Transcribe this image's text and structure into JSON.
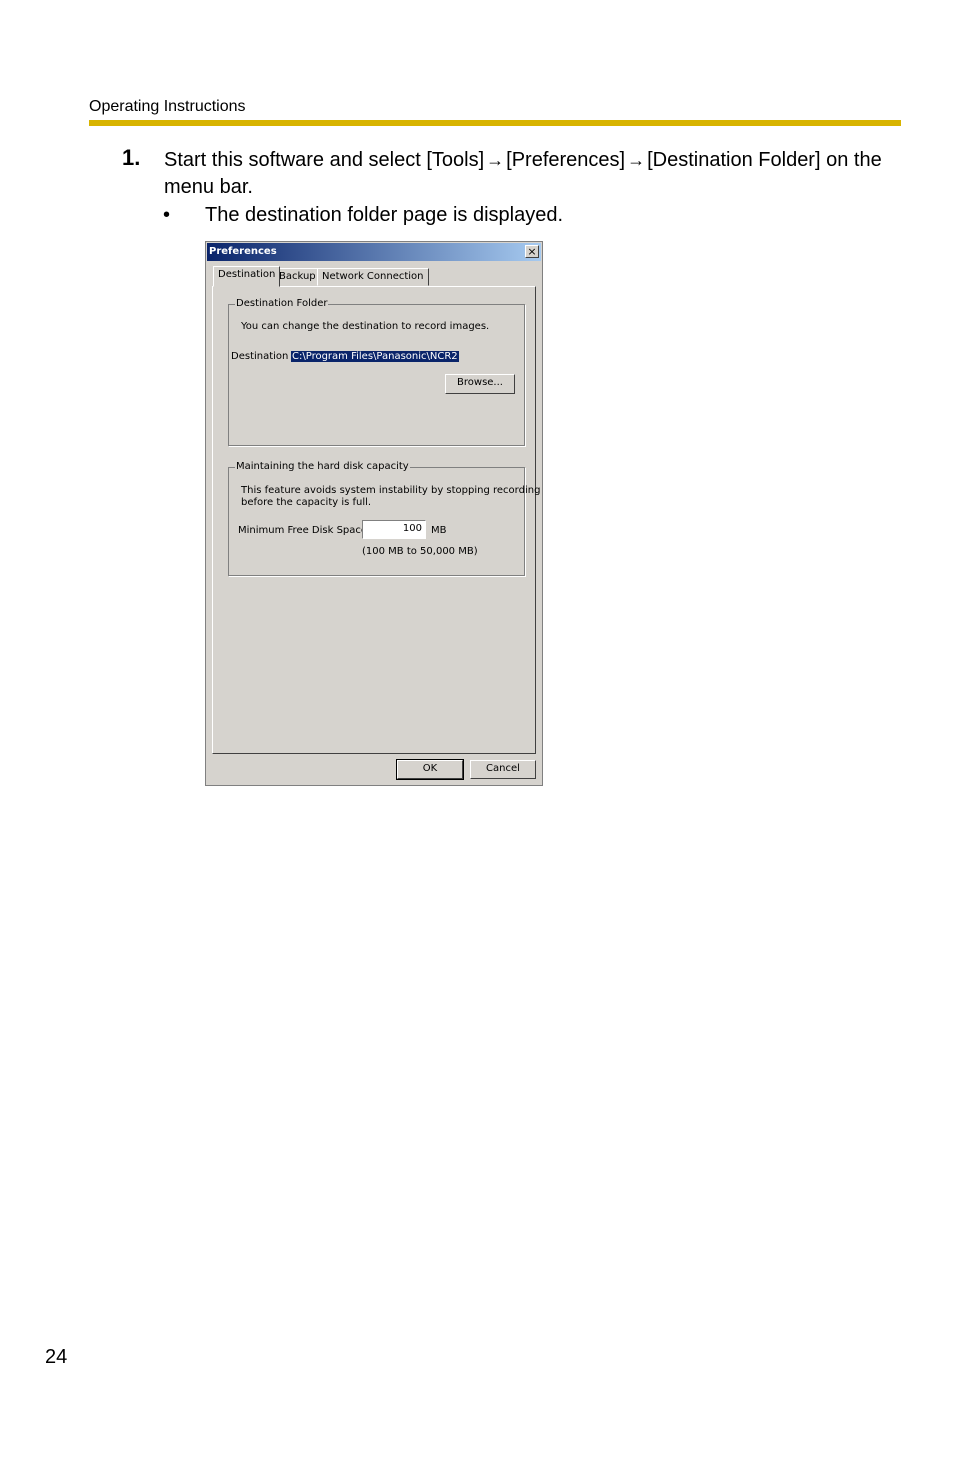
{
  "header": {
    "title": "Operating Instructions"
  },
  "step": {
    "number": "1.",
    "text_part1": "Start this software and select [Tools]",
    "arrow": "→",
    "text_part2": "[Preferences]",
    "text_part3": "[Destination Folder] on the menu bar.",
    "bullet": "•",
    "bullet_text": "The destination folder page is displayed."
  },
  "dialog": {
    "title": "Preferences",
    "close_glyph": "×",
    "tabs": [
      {
        "label": "Destination",
        "active": true
      },
      {
        "label": "Backup",
        "active": false
      },
      {
        "label": "Network Connection",
        "active": false
      }
    ],
    "destination_group": {
      "title": "Destination Folder",
      "description": "You can change the destination to record images.",
      "label": "Destination :",
      "value": "C:\\Program Files\\Panasonic\\NCR2",
      "browse_label": "Browse..."
    },
    "capacity_group": {
      "title": "Maintaining the hard disk capacity",
      "description_line1": "This feature avoids system instability by stopping recording",
      "description_line2": "before the capacity is full.",
      "min_label": "Minimum Free Disk Space :",
      "min_value": "100",
      "unit": "MB",
      "range": "(100 MB to 50,000 MB)"
    },
    "ok_label": "OK",
    "cancel_label": "Cancel"
  },
  "page_number": "24",
  "colors": {
    "header_rule": "#d8b400",
    "titlebar": "#0a246a",
    "dialog_bg": "#d6d3ce"
  }
}
